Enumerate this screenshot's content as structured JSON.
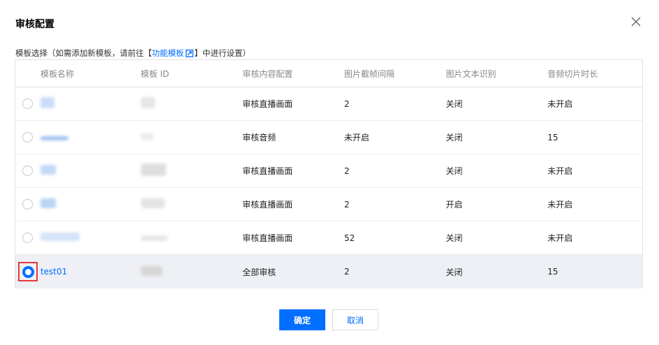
{
  "dialog": {
    "title": "审核配置",
    "close_icon": "close-icon"
  },
  "hint": {
    "prefix": "模板选择（如需添加新模板，请前往【",
    "link": "功能模板",
    "suffix": "】中进行设置）",
    "link_icon": "external-link-icon"
  },
  "table": {
    "headers": [
      "模板名称",
      "模板 ID",
      "审核内容配置",
      "图片截帧间隔",
      "图片文本识别",
      "音频切片时长"
    ],
    "rows": [
      {
        "name": "",
        "id": "",
        "content": "审核直播画面",
        "interval": "2",
        "ocr": "关闭",
        "audio": "未开启",
        "selected": false
      },
      {
        "name": "",
        "id": "",
        "content": "审核音频",
        "interval": "未开启",
        "ocr": "关闭",
        "audio": "15",
        "selected": false
      },
      {
        "name": "",
        "id": "",
        "content": "审核直播画面",
        "interval": "2",
        "ocr": "关闭",
        "audio": "未开启",
        "selected": false
      },
      {
        "name": "",
        "id": "",
        "content": "审核直播画面",
        "interval": "2",
        "ocr": "开启",
        "audio": "未开启",
        "selected": false
      },
      {
        "name": "",
        "id": "",
        "content": "审核直播画面",
        "interval": "52",
        "ocr": "关闭",
        "audio": "未开启",
        "selected": false
      },
      {
        "name": "test01",
        "id": "",
        "content": "全部审核",
        "interval": "2",
        "ocr": "关闭",
        "audio": "15",
        "selected": true
      }
    ]
  },
  "buttons": {
    "confirm": "确定",
    "cancel": "取消"
  },
  "colors": {
    "accent": "#006eff",
    "highlight_box": "#e53935",
    "selected_row": "#eef0f5"
  }
}
